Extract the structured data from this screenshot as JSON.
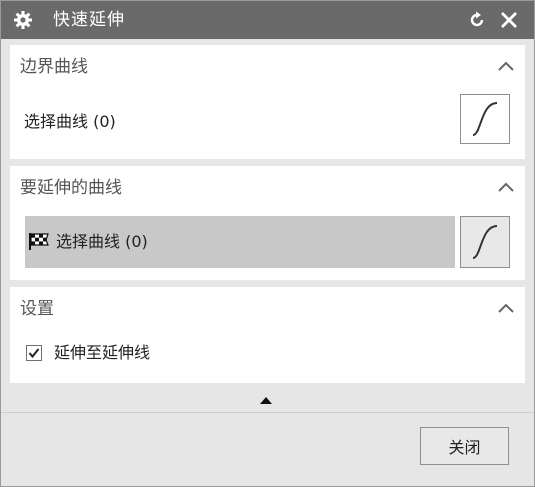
{
  "window": {
    "title": "快速延伸",
    "icons": {
      "title": "gear-icon",
      "reset": "reset-icon",
      "close": "close-icon"
    }
  },
  "sections": [
    {
      "title": "边界曲线",
      "row": {
        "label": "选择曲线 (0)",
        "button_icon": "curve-icon"
      },
      "collapse_icon": "chevron-up-icon"
    },
    {
      "title": "要延伸的曲线",
      "row": {
        "label": "选择曲线 (0)",
        "indicator_icon": "checkered-flag-icon",
        "button_icon": "curve-icon",
        "active": true
      },
      "collapse_icon": "chevron-up-icon"
    },
    {
      "title": "设置",
      "checkbox": {
        "label": "延伸至延伸线",
        "checked": true
      },
      "collapse_icon": "chevron-up-icon"
    }
  ],
  "footer": {
    "more_icon": "triangle-up-icon",
    "close_label": "关闭"
  },
  "colors": {
    "titlebar": "#6a6a6a",
    "active_row": "#c8c8c8",
    "panel": "#ffffff",
    "background": "#e6e6e6"
  }
}
